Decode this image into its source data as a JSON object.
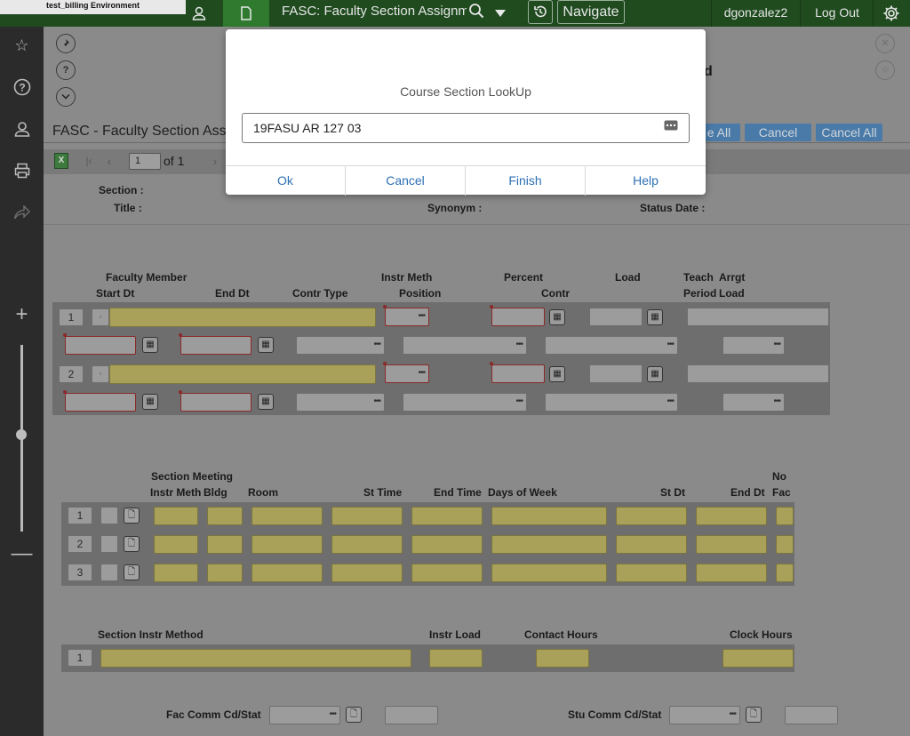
{
  "topbar": {
    "environment": "test_billing Environment",
    "title": "FASC: Faculty Section Assignmer",
    "navigate_label": "Navigate",
    "username": "dgonzalez2",
    "logout_label": "Log Out"
  },
  "form": {
    "title": "FASC - Faculty Section Ass",
    "title_obscured_right": "d",
    "buttons": {
      "save_all_partial": "e All",
      "cancel": "Cancel",
      "cancel_all": "Cancel All"
    },
    "pager": {
      "page": "1",
      "of_label": "of 1"
    },
    "header_labels": {
      "section": "Section :",
      "title": "Title :",
      "synonym": "Synonym :",
      "status_date": "Status Date :"
    },
    "faculty_grid": {
      "headers": {
        "faculty_member": "Faculty Member",
        "start_dt": "Start Dt",
        "end_dt": "End Dt",
        "contr_type": "Contr Type",
        "instr_meth": "Instr Meth",
        "position": "Position",
        "percent": "Percent",
        "contr": "Contr",
        "load": "Load",
        "teach": "Teach",
        "period": "Period",
        "arrgt": "Arrgt",
        "arrgt_load": "Load"
      },
      "rows": [
        "1",
        "2"
      ]
    },
    "meeting_grid": {
      "headers": {
        "section_meeting": "Section Meeting",
        "instr_meth": "Instr Meth",
        "bldg": "Bldg",
        "room": "Room",
        "st_time": "St Time",
        "end_time": "End Time",
        "days_of_week": "Days of Week",
        "st_dt": "St Dt",
        "end_dt": "End Dt",
        "no": "No",
        "fac": "Fac"
      },
      "rows": [
        "1",
        "2",
        "3"
      ]
    },
    "instr_method_grid": {
      "headers": {
        "section_instr_method": "Section Instr Method",
        "instr_load": "Instr Load",
        "contact_hours": "Contact Hours",
        "clock_hours": "Clock Hours"
      },
      "rows": [
        "1"
      ]
    },
    "footer_labels": {
      "fac_comm": "Fac Comm Cd/Stat",
      "stu_comm": "Stu Comm Cd/Stat"
    }
  },
  "modal": {
    "title": "Course Section LookUp",
    "input_value": "19FASU AR 127 03",
    "buttons": {
      "ok": "Ok",
      "cancel": "Cancel",
      "finish": "Finish",
      "help": "Help"
    }
  }
}
